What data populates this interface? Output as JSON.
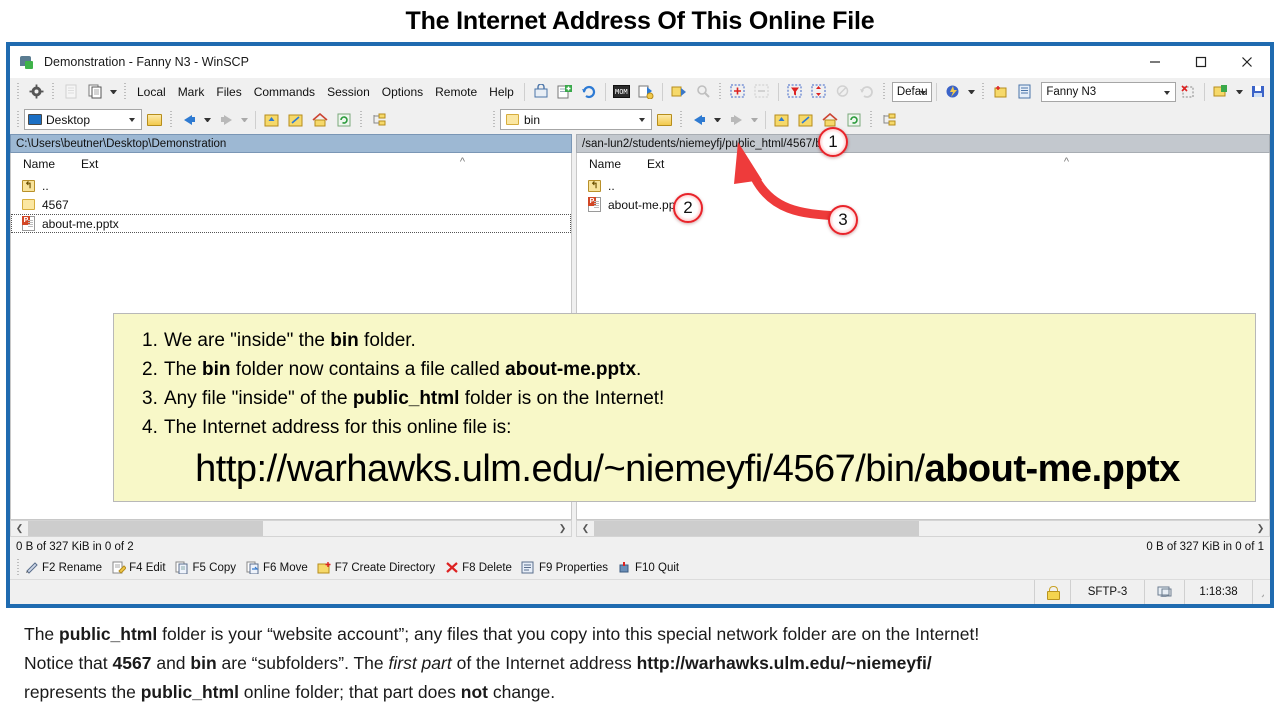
{
  "slide": {
    "title": "The Internet Address Of This Online File"
  },
  "window": {
    "title": "Demonstration - Fanny N3 - WinSCP",
    "icon": "winscp-icon",
    "controls": {
      "minimize": "minimize-icon",
      "maximize": "maximize-icon",
      "close": "close-icon"
    }
  },
  "menu": {
    "items": [
      "Local",
      "Mark",
      "Files",
      "Commands",
      "Session",
      "Options",
      "Remote",
      "Help"
    ]
  },
  "toolbar": {
    "transfer_settings_value": "Defau",
    "session_value": "Fanny N3",
    "icons": [
      "preferences-gear-icon",
      "copy-file-icon",
      "duplicate-icon",
      "lock-session-icon",
      "new-session-icon",
      "refresh-icon",
      "console-icon",
      "synchronize-icon",
      "synchronize-browsing-icon",
      "find-files-icon",
      "select-add-icon",
      "select-remove-icon",
      "select-filter-icon",
      "invert-selection-icon",
      "clear-selection-icon",
      "restore-selection-icon",
      "transfer-mode-icon",
      "new-folder-icon",
      "properties-icon",
      "disconnect-icon",
      "save-session-icon",
      "save-workspace-icon"
    ]
  },
  "local_panel": {
    "drive_combo_value": "Desktop",
    "drive_icon": "desktop-icon",
    "nav_icons": [
      "open-folder-icon",
      "back-arrow-icon",
      "forward-arrow-icon",
      "parent-folder-icon",
      "recent-folder-icon",
      "home-folder-icon",
      "refresh-folder-icon",
      "tree-icon"
    ],
    "path": "C:\\Users\\beutner\\Desktop\\Demonstration",
    "columns": [
      "Name",
      "Ext"
    ],
    "sort_indicator": "sort-ascending-caret",
    "rows": [
      {
        "icon": "parent-directory-icon",
        "name": "..",
        "ext": "",
        "focused": false
      },
      {
        "icon": "folder-icon",
        "name": "4567",
        "ext": "",
        "focused": false
      },
      {
        "icon": "powerpoint-file-icon",
        "name": "about-me.pptx",
        "ext": "",
        "focused": true
      }
    ],
    "scrollbar": {
      "left_arrow": "scroll-left-icon",
      "right_arrow": "scroll-right-icon"
    },
    "status": "0 B of 327 KiB in 0 of 2"
  },
  "remote_panel": {
    "folder_combo_value": "bin",
    "folder_icon": "folder-icon",
    "nav_icons": [
      "open-folder-icon",
      "back-arrow-icon",
      "forward-arrow-icon",
      "parent-folder-icon",
      "recent-folder-icon",
      "home-folder-icon",
      "refresh-folder-icon",
      "tree-icon"
    ],
    "path": "/san-lun2/students/niemeyfj/public_html/4567/bin",
    "columns": [
      "Name",
      "Ext"
    ],
    "sort_indicator": "sort-ascending-caret",
    "rows": [
      {
        "icon": "parent-directory-icon",
        "name": "..",
        "ext": "",
        "focused": false
      },
      {
        "icon": "powerpoint-file-icon",
        "name": "about-me.pptx",
        "ext": "",
        "focused": false
      }
    ],
    "scrollbar": {
      "left_arrow": "scroll-left-icon",
      "right_arrow": "scroll-right-icon"
    },
    "status": "0 B of 327 KiB in 0 of 1"
  },
  "fkeys": [
    {
      "icon": "rename-icon",
      "label": "F2 Rename"
    },
    {
      "icon": "edit-icon",
      "label": "F4 Edit"
    },
    {
      "icon": "copy-icon",
      "label": "F5 Copy"
    },
    {
      "icon": "move-icon",
      "label": "F6 Move"
    },
    {
      "icon": "create-directory-icon",
      "label": "F7 Create Directory"
    },
    {
      "icon": "delete-icon",
      "label": "F8 Delete"
    },
    {
      "icon": "properties-icon",
      "label": "F9 Properties"
    },
    {
      "icon": "quit-icon",
      "label": "F10 Quit"
    }
  ],
  "statusbar": {
    "lock_icon": "padlock-icon",
    "protocol": "SFTP-3",
    "monitor_icon": "monitor-icon",
    "time": "1:18:38",
    "resize_grip": "resize-grip-icon"
  },
  "callout": {
    "items": [
      {
        "num": "1.",
        "parts": [
          {
            "t": "We are \"inside\" the "
          },
          {
            "t": "bin",
            "b": true
          },
          {
            "t": " folder."
          }
        ]
      },
      {
        "num": "2.",
        "parts": [
          {
            "t": "The "
          },
          {
            "t": "bin",
            "b": true
          },
          {
            "t": " folder now contains a file called  "
          },
          {
            "t": "about-me.pptx",
            "b": true
          },
          {
            "t": "."
          }
        ]
      },
      {
        "num": "3.",
        "parts": [
          {
            "t": "Any file \"inside\" of the "
          },
          {
            "t": "public_html",
            "b": true
          },
          {
            "t": " folder is on the Internet!"
          }
        ]
      },
      {
        "num": "4.",
        "parts": [
          {
            "t": "The Internet address for this online file is:"
          }
        ]
      }
    ],
    "url_prefix": "http://warhawks.ulm.edu/~niemeyfi/4567/bin/",
    "url_file": "about-me.pptx"
  },
  "annotations": {
    "markers": [
      {
        "id": "1",
        "label": "1"
      },
      {
        "id": "2",
        "label": "2"
      },
      {
        "id": "3",
        "label": "3"
      }
    ],
    "arrow_color": "#ee3b3b"
  },
  "caption": {
    "lines": [
      [
        {
          "t": "The "
        },
        {
          "t": "public_html",
          "b": true
        },
        {
          "t": " folder is your “website account”; any files that you copy into this special network folder are on the Internet!"
        }
      ],
      [
        {
          "t": "Notice that "
        },
        {
          "t": "4567",
          "b": true
        },
        {
          "t": " and "
        },
        {
          "t": "bin",
          "b": true
        },
        {
          "t": " are “subfolders”. The "
        },
        {
          "t": "first part",
          "i": true
        },
        {
          "t": " of the Internet address "
        },
        {
          "t": "http://warhawks.ulm.edu/~niemeyfi/",
          "b": true
        }
      ],
      [
        {
          "t": "represents the "
        },
        {
          "t": "public_html",
          "b": true
        },
        {
          "t": " online folder; that part does "
        },
        {
          "t": "not",
          "b": true
        },
        {
          "t": " change."
        }
      ]
    ]
  },
  "colors": {
    "window_border": "#1f6bb0",
    "active_path_bar": "#9db8d3",
    "inactive_path_bar": "#c3c8ce",
    "callout_background": "#f8f8c8",
    "annotation_red": "#e8232a"
  }
}
